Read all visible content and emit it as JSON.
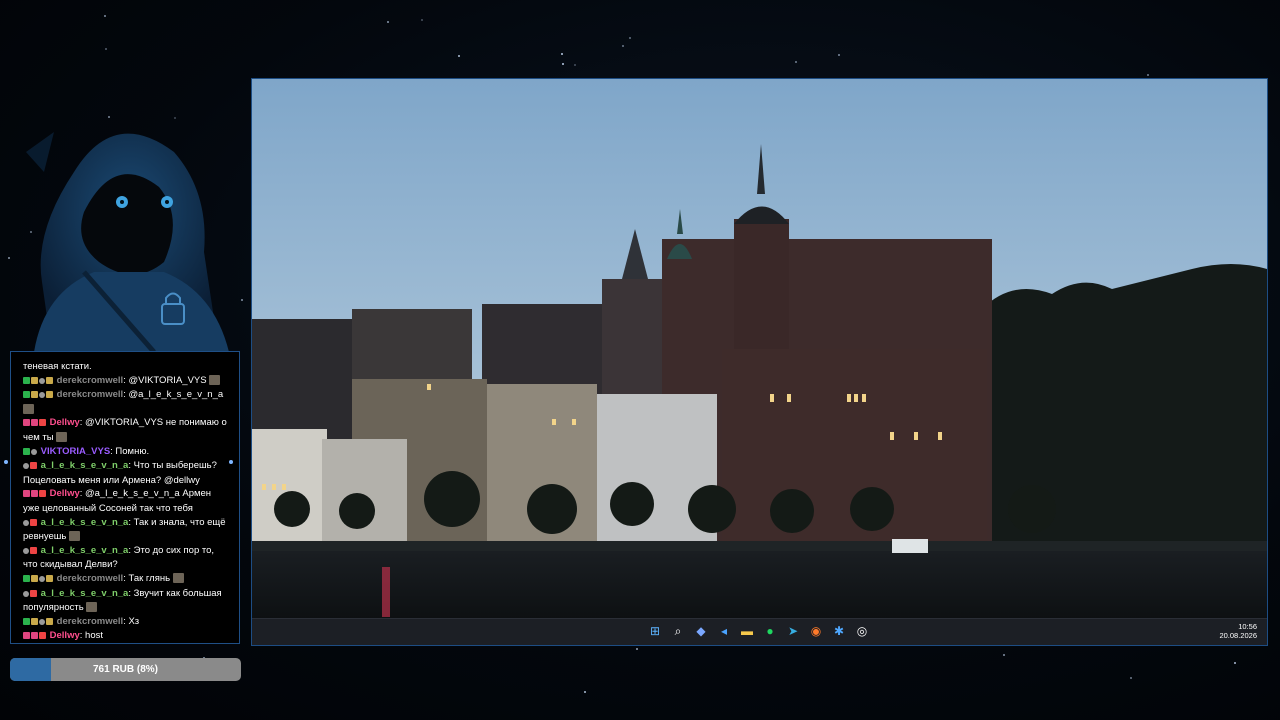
{
  "chat": {
    "messages": [
      {
        "user": "",
        "text": "теневая кстати.",
        "badges": []
      },
      {
        "user": "derekcromwell",
        "sep": ":",
        "text": " @VIKTORIA_VYS",
        "badges": [
          "green",
          "gold",
          "grey",
          "gold"
        ],
        "emote": true
      },
      {
        "user": "derekcromwell",
        "sep": ":",
        "text": " @a_l_e_k_s_e_v_n_a",
        "badges": [
          "green",
          "gold",
          "grey",
          "gold"
        ],
        "emote": true
      },
      {
        "user": "Dellwy",
        "sep": ":",
        "text": " @VIKTORIA_VYS не понимаю о чем ты",
        "badges": [
          "pink",
          "pink",
          "red"
        ],
        "emote": true
      },
      {
        "user": "VIKTORIA_VYS",
        "sep": ":",
        "text": " Помню.",
        "badges": [
          "green",
          "grey"
        ]
      },
      {
        "user": "a_l_e_k_s_e_v_n_a",
        "sep": ":",
        "text": " Что ты выберешь? Поцеловать меня или Армена? @dellwy",
        "badges": [
          "grey",
          "red"
        ],
        "emote": false
      },
      {
        "user": "Dellwy",
        "sep": ":",
        "text": " @a_l_e_k_s_e_v_n_a Армен уже целованный Сосоней так что тебя",
        "badges": [
          "pink",
          "pink",
          "red"
        ]
      },
      {
        "user": "a_l_e_k_s_e_v_n_a",
        "sep": ":",
        "text": " Так и знала, что ещё ревнуешь",
        "badges": [
          "grey",
          "red"
        ],
        "emote": true
      },
      {
        "user": "a_l_e_k_s_e_v_n_a",
        "sep": ":",
        "text": " Это до сих пор то, что скидывал Делви?",
        "badges": [
          "grey",
          "red"
        ]
      },
      {
        "user": "derekcromwell",
        "sep": ":",
        "text": " Так глянь",
        "badges": [
          "green",
          "gold",
          "grey",
          "gold"
        ],
        "emote": true
      },
      {
        "user": "a_l_e_k_s_e_v_n_a",
        "sep": ":",
        "text": " Звучит как большая популярность",
        "badges": [
          "grey",
          "red"
        ],
        "emote": true
      },
      {
        "user": "derekcromwell",
        "sep": ":",
        "text": " Хз",
        "badges": [
          "green",
          "gold",
          "grey",
          "gold"
        ]
      },
      {
        "user": "Dellwy",
        "sep": ":",
        "text": " host",
        "badges": [
          "pink",
          "pink",
          "red"
        ]
      }
    ]
  },
  "donation": {
    "label": "761 RUB (8%)",
    "progress": 0.08
  },
  "taskbar": {
    "icons": [
      "windows-start-icon",
      "search-icon",
      "app-icon",
      "vscode-icon",
      "folder-icon",
      "spotify-icon",
      "telegram-icon",
      "firefox-icon",
      "snowflake-icon",
      "obs-icon"
    ],
    "time": "10:56",
    "date": "20.08.2026"
  }
}
